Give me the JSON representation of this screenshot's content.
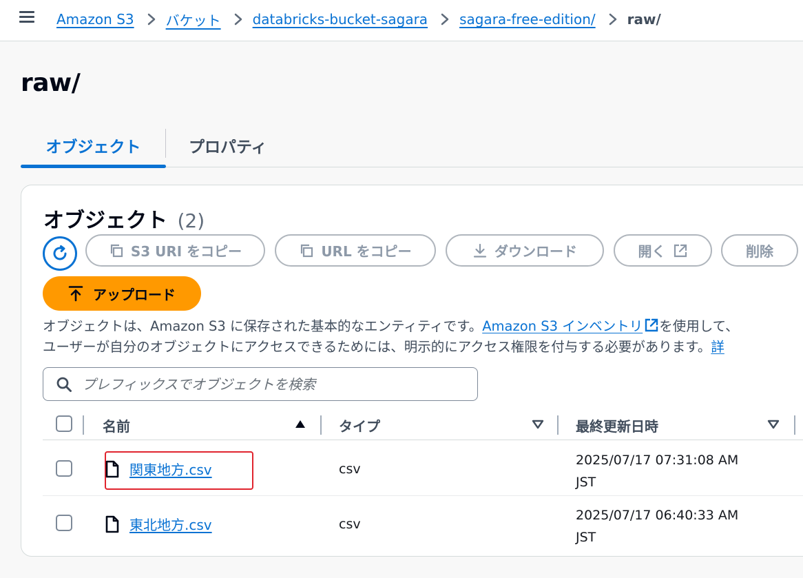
{
  "breadcrumb": {
    "items": [
      "Amazon S3",
      "バケット",
      "databricks-bucket-sagara",
      "sagara-free-edition/"
    ],
    "current": "raw/"
  },
  "page": {
    "title": "raw/"
  },
  "tabs": [
    {
      "label": "オブジェクト",
      "active": true
    },
    {
      "label": "プロパティ",
      "active": false
    }
  ],
  "panel": {
    "title": "オブジェクト",
    "count": "(2)",
    "buttons": {
      "copy_s3_uri": "S3 URI をコピー",
      "copy_url": "URL をコピー",
      "download": "ダウンロード",
      "open": "開く",
      "delete": "削除",
      "upload": "アップロード"
    },
    "description": {
      "line1_before": "オブジェクトは、Amazon S3 に保存された基本的なエンティティです。",
      "line1_link": "Amazon S3 インベントリ",
      "line1_after": "を使用して、",
      "line2": "ユーザーが自分のオブジェクトにアクセスできるためには、明示的にアクセス権限を付与する必要があります。",
      "line2_link": "詳"
    },
    "search": {
      "placeholder": "プレフィックスでオブジェクトを検索"
    },
    "table": {
      "columns": {
        "name": "名前",
        "type": "タイプ",
        "modified": "最終更新日時"
      },
      "rows": [
        {
          "name": "関東地方.csv",
          "type": "csv",
          "date_line1": "2025/07/17 07:31:08 AM",
          "date_line2": "JST",
          "highlighted": true
        },
        {
          "name": "東北地方.csv",
          "type": "csv",
          "date_line1": "2025/07/17 06:40:33 AM",
          "date_line2": "JST",
          "highlighted": false
        }
      ]
    }
  },
  "colors": {
    "link": "#0972d3",
    "upload_button": "#ff9900",
    "highlight_box": "#e0242e"
  },
  "icons": [
    "hamburger-icon",
    "chevron-right-icon",
    "refresh-icon",
    "copy-icon",
    "download-icon",
    "external-link-icon",
    "upload-icon",
    "search-icon",
    "sort-ascending-icon",
    "sort-dropdown-icon",
    "file-icon"
  ]
}
